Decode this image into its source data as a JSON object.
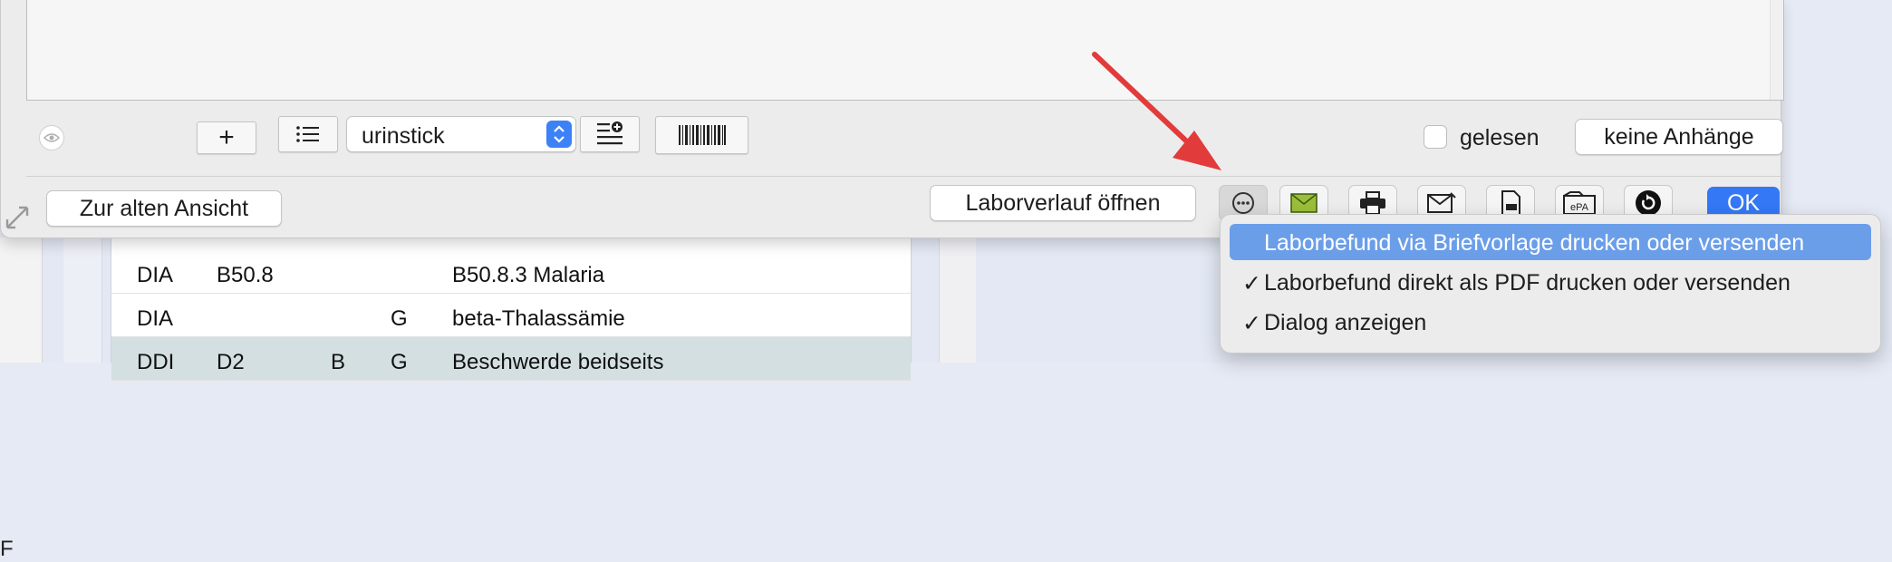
{
  "background": {
    "left_edge_char": "F",
    "table_rows": [
      {
        "c1": "DIA",
        "c2": "B50.8",
        "c3": "",
        "c4": "",
        "c5": "B50.8.3 Malaria",
        "selected": false
      },
      {
        "c1": "DIA",
        "c2": "",
        "c3": "",
        "c4": "G",
        "c5": "beta-Thalassämie",
        "selected": false
      },
      {
        "c1": "DDI",
        "c2": "D2",
        "c3": "B",
        "c4": "G",
        "c5": "Beschwerde beidseits",
        "selected": true
      }
    ]
  },
  "toolbar": {
    "add_label": "+",
    "type_select_value": "urinstick",
    "read_label": "gelesen",
    "attachments_label": "keine Anhänge",
    "old_view_label": "Zur alten Ansicht",
    "lab_history_label": "Laborverlauf öffnen",
    "ok_label": "OK",
    "epa_label": "ePA"
  },
  "context_menu": {
    "items": [
      {
        "label": "Laborbefund via Briefvorlage drucken oder versenden",
        "checked": false,
        "highlighted": true
      },
      {
        "label": "Laborbefund direkt als PDF drucken oder versenden",
        "checked": true,
        "highlighted": false
      },
      {
        "label": "Dialog anzeigen",
        "checked": true,
        "highlighted": false
      }
    ],
    "check_glyph": "✓"
  },
  "colors": {
    "accent": "#3478f6",
    "menu_highlight": "#6b9ee9",
    "arrow": "#e23b3b"
  }
}
